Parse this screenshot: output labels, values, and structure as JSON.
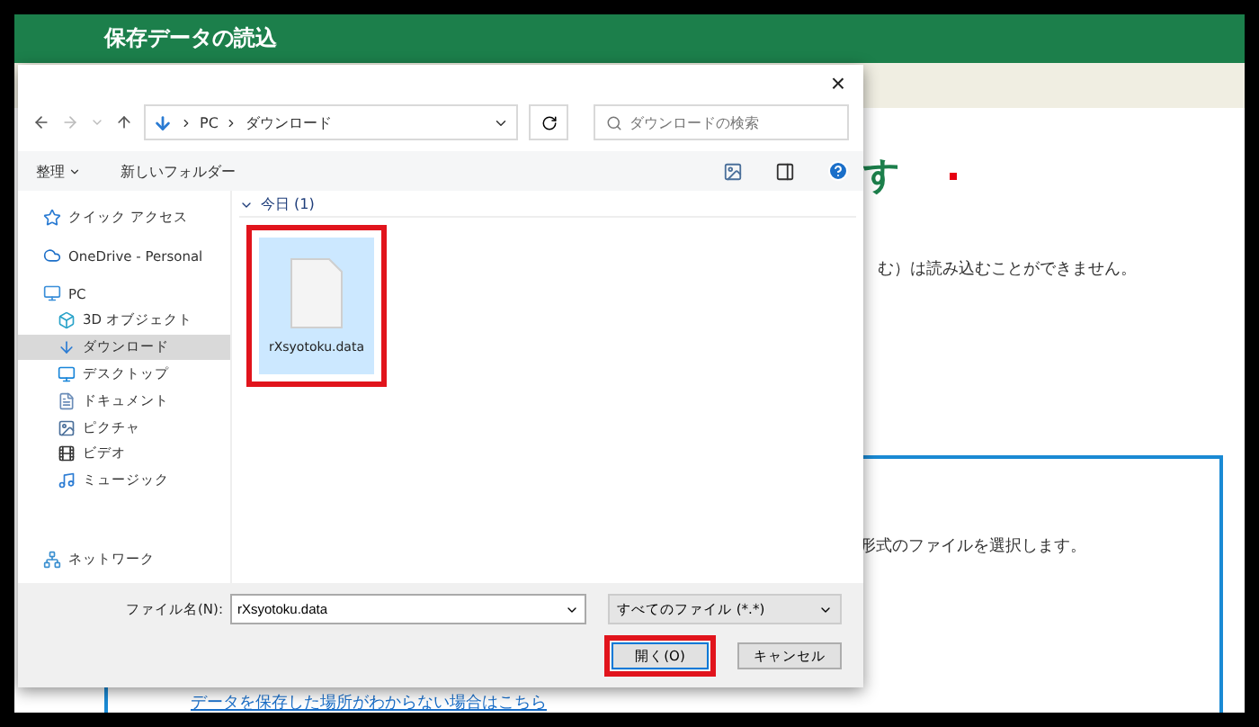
{
  "page": {
    "title": "保存データの読込",
    "heading_fragment": "す",
    "notice_fragment": "む）は読み込むことができません。",
    "select_fragment": "形式のファイルを選択します。",
    "help_link": "データを保存した場所がわからない場合はこちら"
  },
  "dialog": {
    "close": "×",
    "path": [
      "PC",
      "ダウンロード"
    ],
    "search": {
      "placeholder": "ダウンロードの検索"
    },
    "toolbar": {
      "organize": "整理",
      "new_folder": "新しいフォルダー"
    },
    "sidebar": [
      {
        "label": "クイック アクセス",
        "kind": "star",
        "selected": false
      },
      {
        "label": "OneDrive - Personal",
        "kind": "cloud",
        "selected": false
      },
      {
        "label": "PC",
        "kind": "pc",
        "selected": false,
        "children": [
          {
            "label": "3D オブジェクト",
            "kind": "cube",
            "selected": false
          },
          {
            "label": "ダウンロード",
            "kind": "download",
            "selected": true
          },
          {
            "label": "デスクトップ",
            "kind": "desktop",
            "selected": false
          },
          {
            "label": "ドキュメント",
            "kind": "document",
            "selected": false
          },
          {
            "label": "ピクチャ",
            "kind": "picture",
            "selected": false
          },
          {
            "label": "ビデオ",
            "kind": "video",
            "selected": false
          },
          {
            "label": "ミュージック",
            "kind": "music",
            "selected": false
          }
        ]
      },
      {
        "label": "ネットワーク",
        "kind": "network",
        "selected": false
      }
    ],
    "group": {
      "label": "今日 (1)",
      "expanded": true
    },
    "files": [
      {
        "name": "rXsyotoku.data",
        "selected": true
      }
    ],
    "filename_label": "ファイル名(N):",
    "filename": "rXsyotoku.data",
    "filter": "すべてのファイル (*.*)",
    "buttons": [
      {
        "label": "開く(O)",
        "kind": "primary"
      },
      {
        "label": "キャンセル",
        "kind": "normal"
      }
    ]
  }
}
